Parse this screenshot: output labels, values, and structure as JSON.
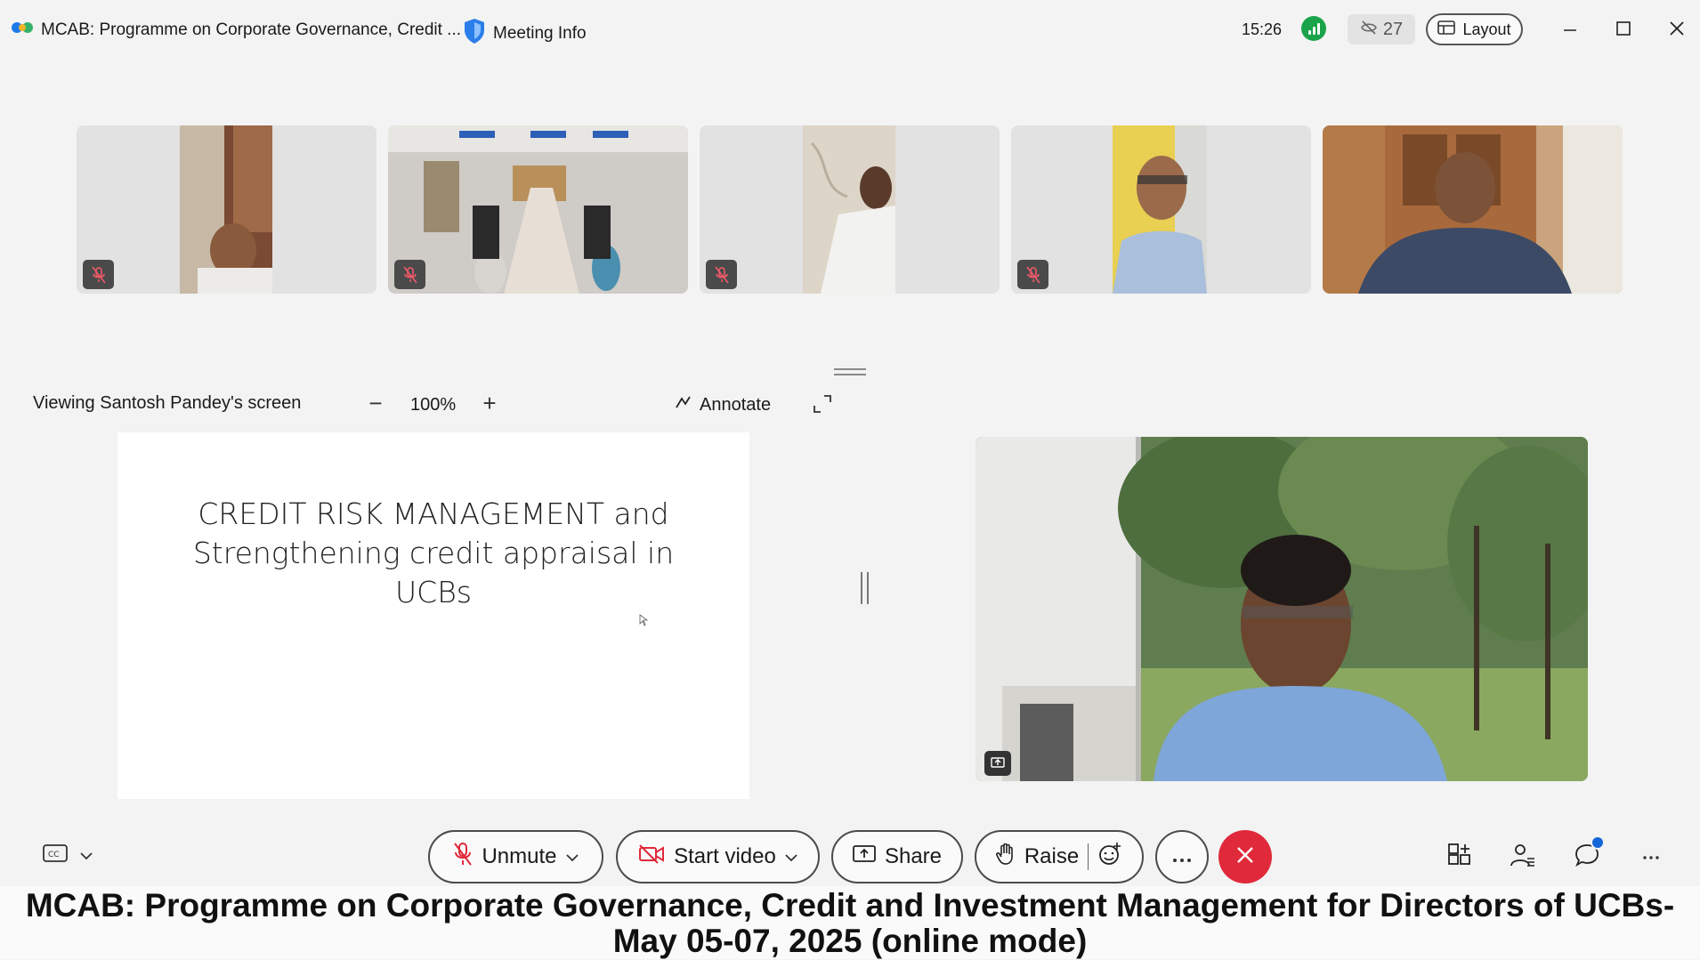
{
  "titlebar": {
    "app_title": "MCAB: Programme on Corporate Governance, Credit ...",
    "meeting_info": "Meeting Info",
    "time": "15:26",
    "participant_count": "27",
    "layout_label": "Layout"
  },
  "thumbnails": [
    {
      "muted": true
    },
    {
      "muted": true
    },
    {
      "muted": true
    },
    {
      "muted": true
    },
    {
      "muted": false
    }
  ],
  "share": {
    "viewing_label": "Viewing Santosh Pandey's screen",
    "zoom_level": "100%",
    "annotate_label": "Annotate",
    "slide_title_lines": [
      "CREDIT RISK MANAGEMENT and",
      "Strengthening credit appraisal in",
      "UCBs"
    ]
  },
  "controls": {
    "unmute_label": "Unmute",
    "start_video_label": "Start video",
    "share_label": "Share",
    "raise_label": "Raise"
  },
  "banner": {
    "line1": "MCAB: Programme on Corporate Governance, Credit and Investment Management for Directors of UCBs-",
    "line2": "May 05-07, 2025 (online mode)"
  },
  "colors": {
    "end_call": "#e0293a",
    "signal": "#1aa34a",
    "notification_dot": "#1565d8",
    "shield": "#2b7de9"
  }
}
